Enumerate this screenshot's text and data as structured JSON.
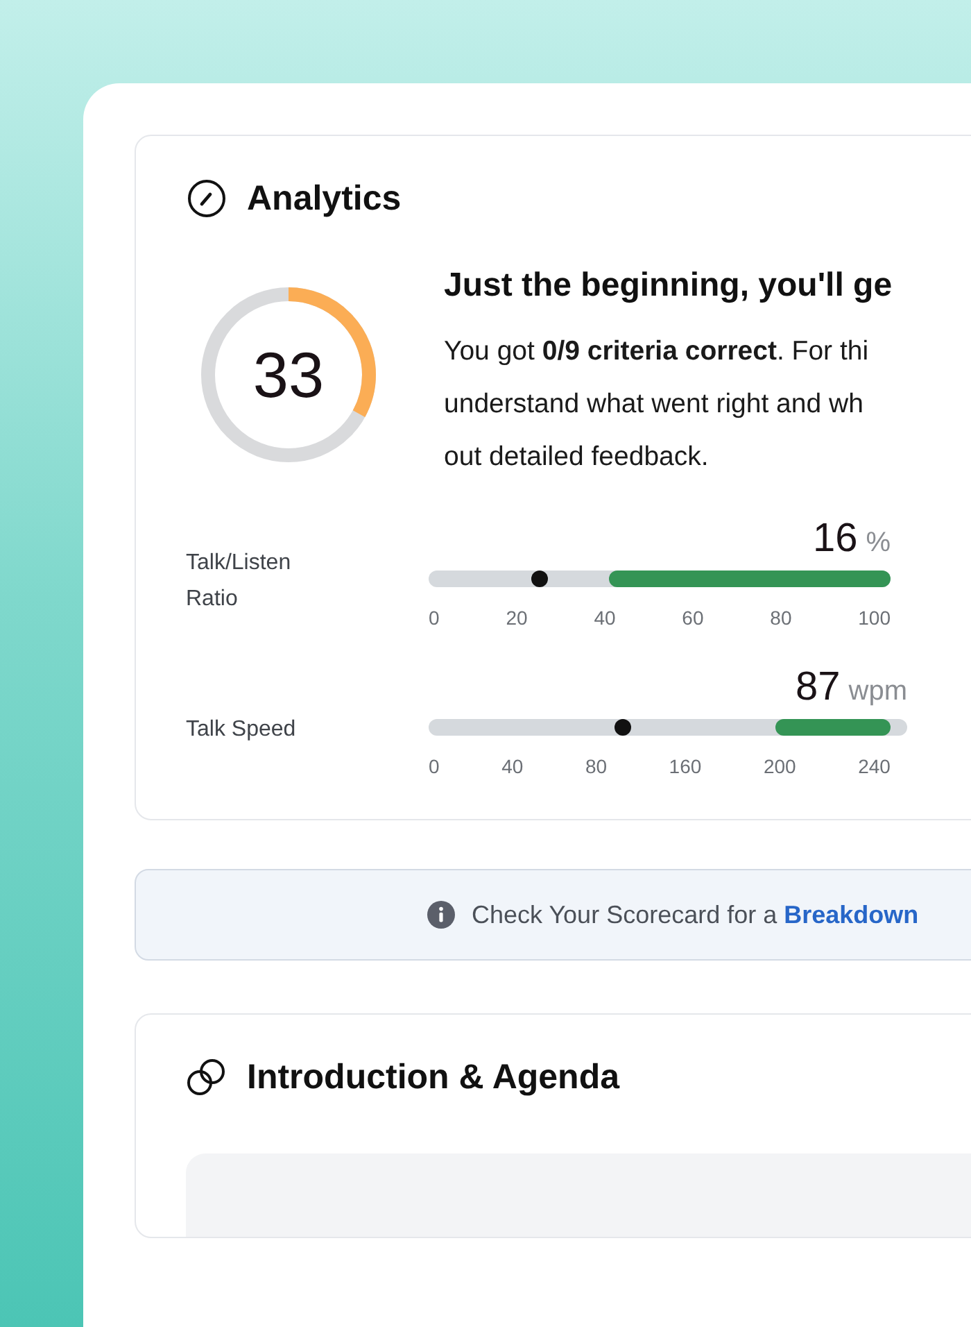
{
  "analytics": {
    "title": "Analytics",
    "score": {
      "value": "33",
      "level": 0.33
    },
    "headline": "Just the beginning, you'll ge",
    "summary_lines": [
      "You got **0/9 criteria correct**. For thi",
      "understand what went right and wh",
      "out detailed feedback."
    ],
    "meters": [
      {
        "label": "Talk/Listen Ratio",
        "value": "16",
        "unit": "%",
        "marker": {
          "level": 0.24
        },
        "target": {
          "level": 0.61
        },
        "ticks": [
          "0",
          "20",
          "40",
          "60",
          "80",
          "100"
        ],
        "extends": false
      },
      {
        "label": "Talk Speed",
        "value": "87",
        "unit": "wpm",
        "marker": {
          "level": 0.42
        },
        "target": {
          "level": 0.25
        },
        "ticks": [
          "0",
          "40",
          "80",
          "160",
          "200",
          "240"
        ],
        "extends": true
      }
    ]
  },
  "banner": {
    "text": "Check Your Scorecard for a ",
    "link": "Breakdown"
  },
  "section": {
    "title": "Introduction & Agenda"
  }
}
